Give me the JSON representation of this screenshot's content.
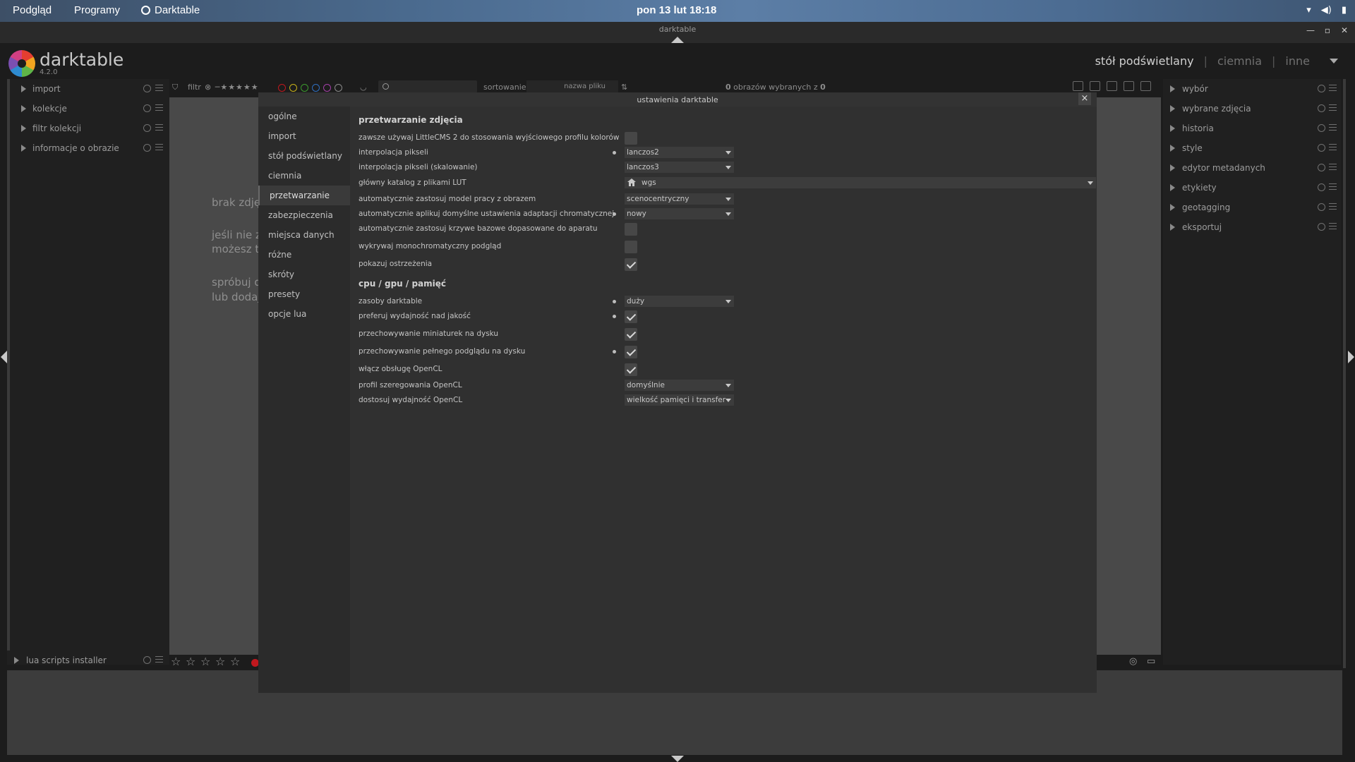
{
  "system_bar": {
    "view_menu": "Podgląd",
    "apps_menu": "Programy",
    "app_name": "Darktable",
    "clock": "pon 13 lut  18:18"
  },
  "window": {
    "title": "darktable"
  },
  "header": {
    "brand": "darktable",
    "version": "4.2.0",
    "views": {
      "lighttable": "stół podświetlany",
      "darkroom": "ciemnia",
      "other": "inne",
      "separator": "|"
    }
  },
  "left_panel": {
    "modules": [
      {
        "label": "import"
      },
      {
        "label": "kolekcje"
      },
      {
        "label": "filtr kolekcji"
      },
      {
        "label": "informacje o obrazie"
      }
    ],
    "bottom_module": "lua scripts installer"
  },
  "toolbar": {
    "filter_label": "filtr",
    "sort_label": "sortowanie:",
    "sort_value": "nazwa pliku",
    "selected_count": "0",
    "selected_text": "obrazów wybranych z",
    "total_count": "0",
    "color_labels": [
      "#c0181e",
      "#c8b21a",
      "#3c9a2e",
      "#2f6fc0",
      "#a43fa8",
      "#8a8a8a"
    ]
  },
  "center": {
    "messages": [
      {
        "text": "brak zdjęć"
      },
      {
        "text": "jeśli nie za"
      },
      {
        "text": "możesz to"
      },
      {
        "text": "spróbuj d"
      },
      {
        "text": "lub dodaj"
      }
    ]
  },
  "right_panel": {
    "modules": [
      {
        "label": "wybór"
      },
      {
        "label": "wybrane zdjęcia"
      },
      {
        "label": "historia"
      },
      {
        "label": "style"
      },
      {
        "label": "edytor metadanych"
      },
      {
        "label": "etykiety"
      },
      {
        "label": "geotagging"
      },
      {
        "label": "eksportuj"
      }
    ]
  },
  "dialog": {
    "title": "ustawienia darktable",
    "close": "×",
    "nav": [
      {
        "label": "ogólne"
      },
      {
        "label": "import"
      },
      {
        "label": "stół podświetlany"
      },
      {
        "label": "ciemnia"
      },
      {
        "label": "przetwarzanie"
      },
      {
        "label": "zabezpieczenia"
      },
      {
        "label": "miejsca danych"
      },
      {
        "label": "różne"
      },
      {
        "label": "skróty"
      },
      {
        "label": "presety"
      },
      {
        "label": "opcje lua"
      }
    ],
    "active_nav": "przetwarzanie",
    "section_processing": "przetwarzanie zdjęcia",
    "section_cpu": "cpu / gpu / pamięć",
    "rows": [
      {
        "label": "zawsze używaj LittleCMS 2 do stosowania wyjściowego profilu kolorów",
        "type": "checkbox",
        "checked": false,
        "modified": false
      },
      {
        "label": "interpolacja pikseli",
        "type": "combo",
        "value": "lanczos2",
        "modified": true
      },
      {
        "label": "interpolacja pikseli (skalowanie)",
        "type": "combo",
        "value": "lanczos3",
        "modified": false
      },
      {
        "label": "główny katalog z plikami LUT",
        "type": "path",
        "value": "wgs",
        "modified": false
      },
      {
        "label": "automatycznie zastosuj model pracy z obrazem",
        "type": "combo",
        "value": "scenocentryczny",
        "modified": false
      },
      {
        "label": "automatycznie aplikuj domyślne ustawienia adaptacji chromatycznej",
        "type": "combo",
        "value": "nowy",
        "modified": true
      },
      {
        "label": "automatycznie zastosuj krzywe bazowe dopasowane do aparatu",
        "type": "checkbox",
        "checked": false,
        "modified": false
      },
      {
        "label": "wykrywaj monochromatyczny podgląd",
        "type": "checkbox",
        "checked": false,
        "modified": false
      },
      {
        "label": "pokazuj ostrzeżenia",
        "type": "checkbox",
        "checked": true,
        "modified": false
      },
      {
        "label": "zasoby darktable",
        "type": "combo",
        "value": "duży",
        "modified": true
      },
      {
        "label": "preferuj wydajność nad jakość",
        "type": "checkbox",
        "checked": true,
        "modified": true
      },
      {
        "label": "przechowywanie miniaturek na dysku",
        "type": "checkbox",
        "checked": true,
        "modified": false
      },
      {
        "label": "przechowywanie pełnego podglądu na dysku",
        "type": "checkbox",
        "checked": true,
        "modified": true
      },
      {
        "label": "włącz obsługę OpenCL",
        "type": "checkbox",
        "checked": true,
        "modified": false
      },
      {
        "label": "profil szeregowania OpenCL",
        "type": "combo",
        "value": "domyślnie",
        "modified": false
      },
      {
        "label": "dostosuj wydajność OpenCL",
        "type": "combo",
        "value": "wielkość pamięci i transfer",
        "modified": false
      }
    ]
  }
}
